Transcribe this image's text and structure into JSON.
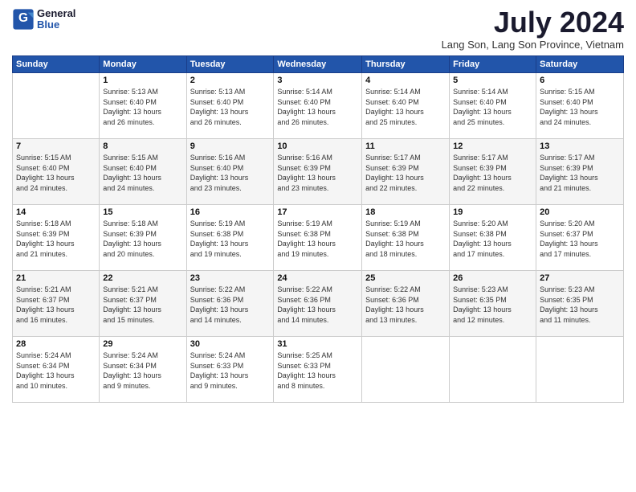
{
  "logo": {
    "line1": "General",
    "line2": "Blue"
  },
  "title": {
    "month_year": "July 2024",
    "location": "Lang Son, Lang Son Province, Vietnam"
  },
  "weekdays": [
    "Sunday",
    "Monday",
    "Tuesday",
    "Wednesday",
    "Thursday",
    "Friday",
    "Saturday"
  ],
  "weeks": [
    [
      {
        "day": "",
        "info": ""
      },
      {
        "day": "1",
        "info": "Sunrise: 5:13 AM\nSunset: 6:40 PM\nDaylight: 13 hours\nand 26 minutes."
      },
      {
        "day": "2",
        "info": "Sunrise: 5:13 AM\nSunset: 6:40 PM\nDaylight: 13 hours\nand 26 minutes."
      },
      {
        "day": "3",
        "info": "Sunrise: 5:14 AM\nSunset: 6:40 PM\nDaylight: 13 hours\nand 26 minutes."
      },
      {
        "day": "4",
        "info": "Sunrise: 5:14 AM\nSunset: 6:40 PM\nDaylight: 13 hours\nand 25 minutes."
      },
      {
        "day": "5",
        "info": "Sunrise: 5:14 AM\nSunset: 6:40 PM\nDaylight: 13 hours\nand 25 minutes."
      },
      {
        "day": "6",
        "info": "Sunrise: 5:15 AM\nSunset: 6:40 PM\nDaylight: 13 hours\nand 24 minutes."
      }
    ],
    [
      {
        "day": "7",
        "info": "Sunrise: 5:15 AM\nSunset: 6:40 PM\nDaylight: 13 hours\nand 24 minutes."
      },
      {
        "day": "8",
        "info": "Sunrise: 5:15 AM\nSunset: 6:40 PM\nDaylight: 13 hours\nand 24 minutes."
      },
      {
        "day": "9",
        "info": "Sunrise: 5:16 AM\nSunset: 6:40 PM\nDaylight: 13 hours\nand 23 minutes."
      },
      {
        "day": "10",
        "info": "Sunrise: 5:16 AM\nSunset: 6:39 PM\nDaylight: 13 hours\nand 23 minutes."
      },
      {
        "day": "11",
        "info": "Sunrise: 5:17 AM\nSunset: 6:39 PM\nDaylight: 13 hours\nand 22 minutes."
      },
      {
        "day": "12",
        "info": "Sunrise: 5:17 AM\nSunset: 6:39 PM\nDaylight: 13 hours\nand 22 minutes."
      },
      {
        "day": "13",
        "info": "Sunrise: 5:17 AM\nSunset: 6:39 PM\nDaylight: 13 hours\nand 21 minutes."
      }
    ],
    [
      {
        "day": "14",
        "info": "Sunrise: 5:18 AM\nSunset: 6:39 PM\nDaylight: 13 hours\nand 21 minutes."
      },
      {
        "day": "15",
        "info": "Sunrise: 5:18 AM\nSunset: 6:39 PM\nDaylight: 13 hours\nand 20 minutes."
      },
      {
        "day": "16",
        "info": "Sunrise: 5:19 AM\nSunset: 6:38 PM\nDaylight: 13 hours\nand 19 minutes."
      },
      {
        "day": "17",
        "info": "Sunrise: 5:19 AM\nSunset: 6:38 PM\nDaylight: 13 hours\nand 19 minutes."
      },
      {
        "day": "18",
        "info": "Sunrise: 5:19 AM\nSunset: 6:38 PM\nDaylight: 13 hours\nand 18 minutes."
      },
      {
        "day": "19",
        "info": "Sunrise: 5:20 AM\nSunset: 6:38 PM\nDaylight: 13 hours\nand 17 minutes."
      },
      {
        "day": "20",
        "info": "Sunrise: 5:20 AM\nSunset: 6:37 PM\nDaylight: 13 hours\nand 17 minutes."
      }
    ],
    [
      {
        "day": "21",
        "info": "Sunrise: 5:21 AM\nSunset: 6:37 PM\nDaylight: 13 hours\nand 16 minutes."
      },
      {
        "day": "22",
        "info": "Sunrise: 5:21 AM\nSunset: 6:37 PM\nDaylight: 13 hours\nand 15 minutes."
      },
      {
        "day": "23",
        "info": "Sunrise: 5:22 AM\nSunset: 6:36 PM\nDaylight: 13 hours\nand 14 minutes."
      },
      {
        "day": "24",
        "info": "Sunrise: 5:22 AM\nSunset: 6:36 PM\nDaylight: 13 hours\nand 14 minutes."
      },
      {
        "day": "25",
        "info": "Sunrise: 5:22 AM\nSunset: 6:36 PM\nDaylight: 13 hours\nand 13 minutes."
      },
      {
        "day": "26",
        "info": "Sunrise: 5:23 AM\nSunset: 6:35 PM\nDaylight: 13 hours\nand 12 minutes."
      },
      {
        "day": "27",
        "info": "Sunrise: 5:23 AM\nSunset: 6:35 PM\nDaylight: 13 hours\nand 11 minutes."
      }
    ],
    [
      {
        "day": "28",
        "info": "Sunrise: 5:24 AM\nSunset: 6:34 PM\nDaylight: 13 hours\nand 10 minutes."
      },
      {
        "day": "29",
        "info": "Sunrise: 5:24 AM\nSunset: 6:34 PM\nDaylight: 13 hours\nand 9 minutes."
      },
      {
        "day": "30",
        "info": "Sunrise: 5:24 AM\nSunset: 6:33 PM\nDaylight: 13 hours\nand 9 minutes."
      },
      {
        "day": "31",
        "info": "Sunrise: 5:25 AM\nSunset: 6:33 PM\nDaylight: 13 hours\nand 8 minutes."
      },
      {
        "day": "",
        "info": ""
      },
      {
        "day": "",
        "info": ""
      },
      {
        "day": "",
        "info": ""
      }
    ]
  ]
}
